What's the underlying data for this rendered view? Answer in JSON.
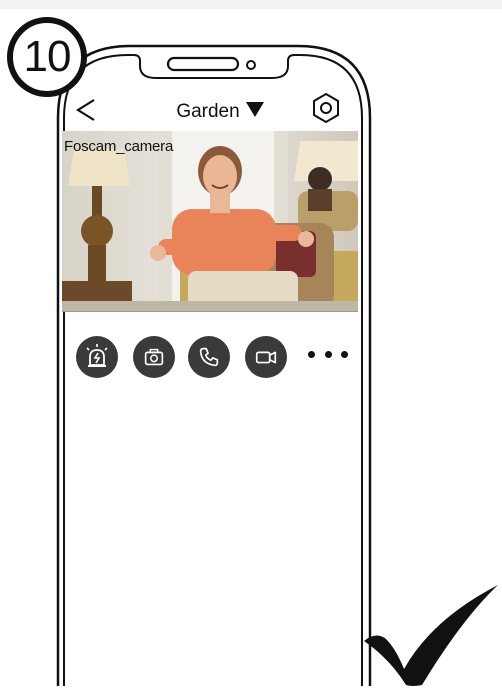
{
  "step_number": "10",
  "header": {
    "back_icon": "chevron-left-icon",
    "title": "Garden",
    "dropdown_icon": "triangle-down-icon",
    "settings_icon": "hexagon-gear-icon"
  },
  "video": {
    "camera_name": "Foscam_camera"
  },
  "controls": [
    {
      "icon": "alarm-siren-icon"
    },
    {
      "icon": "snapshot-camera-icon"
    },
    {
      "icon": "phone-call-icon"
    },
    {
      "icon": "video-record-icon"
    },
    {
      "icon": "more-dots-icon"
    }
  ],
  "overlay_icon": "checkmark-icon",
  "colors": {
    "outline": "#111111",
    "button_fill": "#3a3a3a",
    "icon_stroke": "#ffffff"
  }
}
